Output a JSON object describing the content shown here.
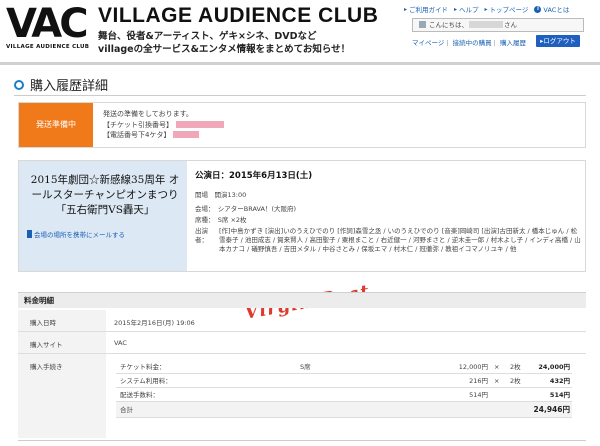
{
  "header": {
    "logo_text": "VAC",
    "logo_sub": "VILLAGE AUDIENCE CLUB",
    "site_title": "VILLAGE AUDIENCE CLUB",
    "tagline_line1": "舞台、役者&アーティスト、ゲキ×シネ、DVDなど",
    "tagline_line2": "villageの全サービス&エンタメ情報をまとめてお知らせ！",
    "top_links": [
      "ご利用ガイド",
      "ヘルプ",
      "トップページ",
      "VACとは"
    ],
    "greeting_prefix": "こんにちは、",
    "greeting_suffix": "さん",
    "sub_links": [
      "マイページ",
      "接続中の購買",
      "購入履歴"
    ],
    "logout_label": "ログアウト"
  },
  "page": {
    "title": "購入履歴詳細"
  },
  "status": {
    "badge": "発送準備中",
    "message": "発送の準備をしております。",
    "ticket_label": "【チケット引換番号】",
    "phone_label": "【電話番号下4ケタ】"
  },
  "event": {
    "name": "2015年劇団☆新感線35周年 オールスターチャンピオンまつり「五右衛門VS轟天」",
    "mail_link": "会場の場所を携帯にメールする",
    "date": "公演日：2015年6月13日(土)",
    "open": "開場　開演13:00",
    "venue": "会場：　シアターBRAVA！(大阪府)",
    "seat": "席種：　S席 ×2枚",
    "cast_label": "出演者：",
    "cast": "[作]中島かずき [演出]いのうえひでのり [作詞]森雪之丞 / いのうえひでのり [音楽]岡崎司 [出演]古田新太 / 橋本じゅん / 松雪泰子 / 池田成志 / 賀来賢人 / 高田聖子 / 粟根まこと / 右近健一 / 河野まさと / 逆木圭一郎 / 村木よし子 / インディ高橋 / 山本カナコ / 礒野慎吾 / 吉田メタル / 中谷さとみ / 保坂エマ / 村木仁 / 冠徹弥 / 教祖イコマノリユキ / 他"
  },
  "watermark": "Virgin Beat",
  "fees": {
    "section_title": "料金明細",
    "purchase_date_label": "購入日時",
    "purchase_date": "2015年2月16日(月) 19:06",
    "site_label": "購入サイト",
    "site": "VAC",
    "method_label": "購入手続き",
    "rows": [
      {
        "name": "チケット料金：",
        "seat": "S席",
        "unit": "12,000円",
        "x": "×",
        "qty": "2枚",
        "amount": "24,000円"
      },
      {
        "name": "システム利用料：",
        "seat": "",
        "unit": "216円",
        "x": "×",
        "qty": "2枚",
        "amount": "432円"
      },
      {
        "name": "配送手数料：",
        "seat": "",
        "unit": "514円",
        "x": "",
        "qty": "",
        "amount": "514円"
      }
    ],
    "total_label": "合計",
    "total": "24,946円"
  }
}
